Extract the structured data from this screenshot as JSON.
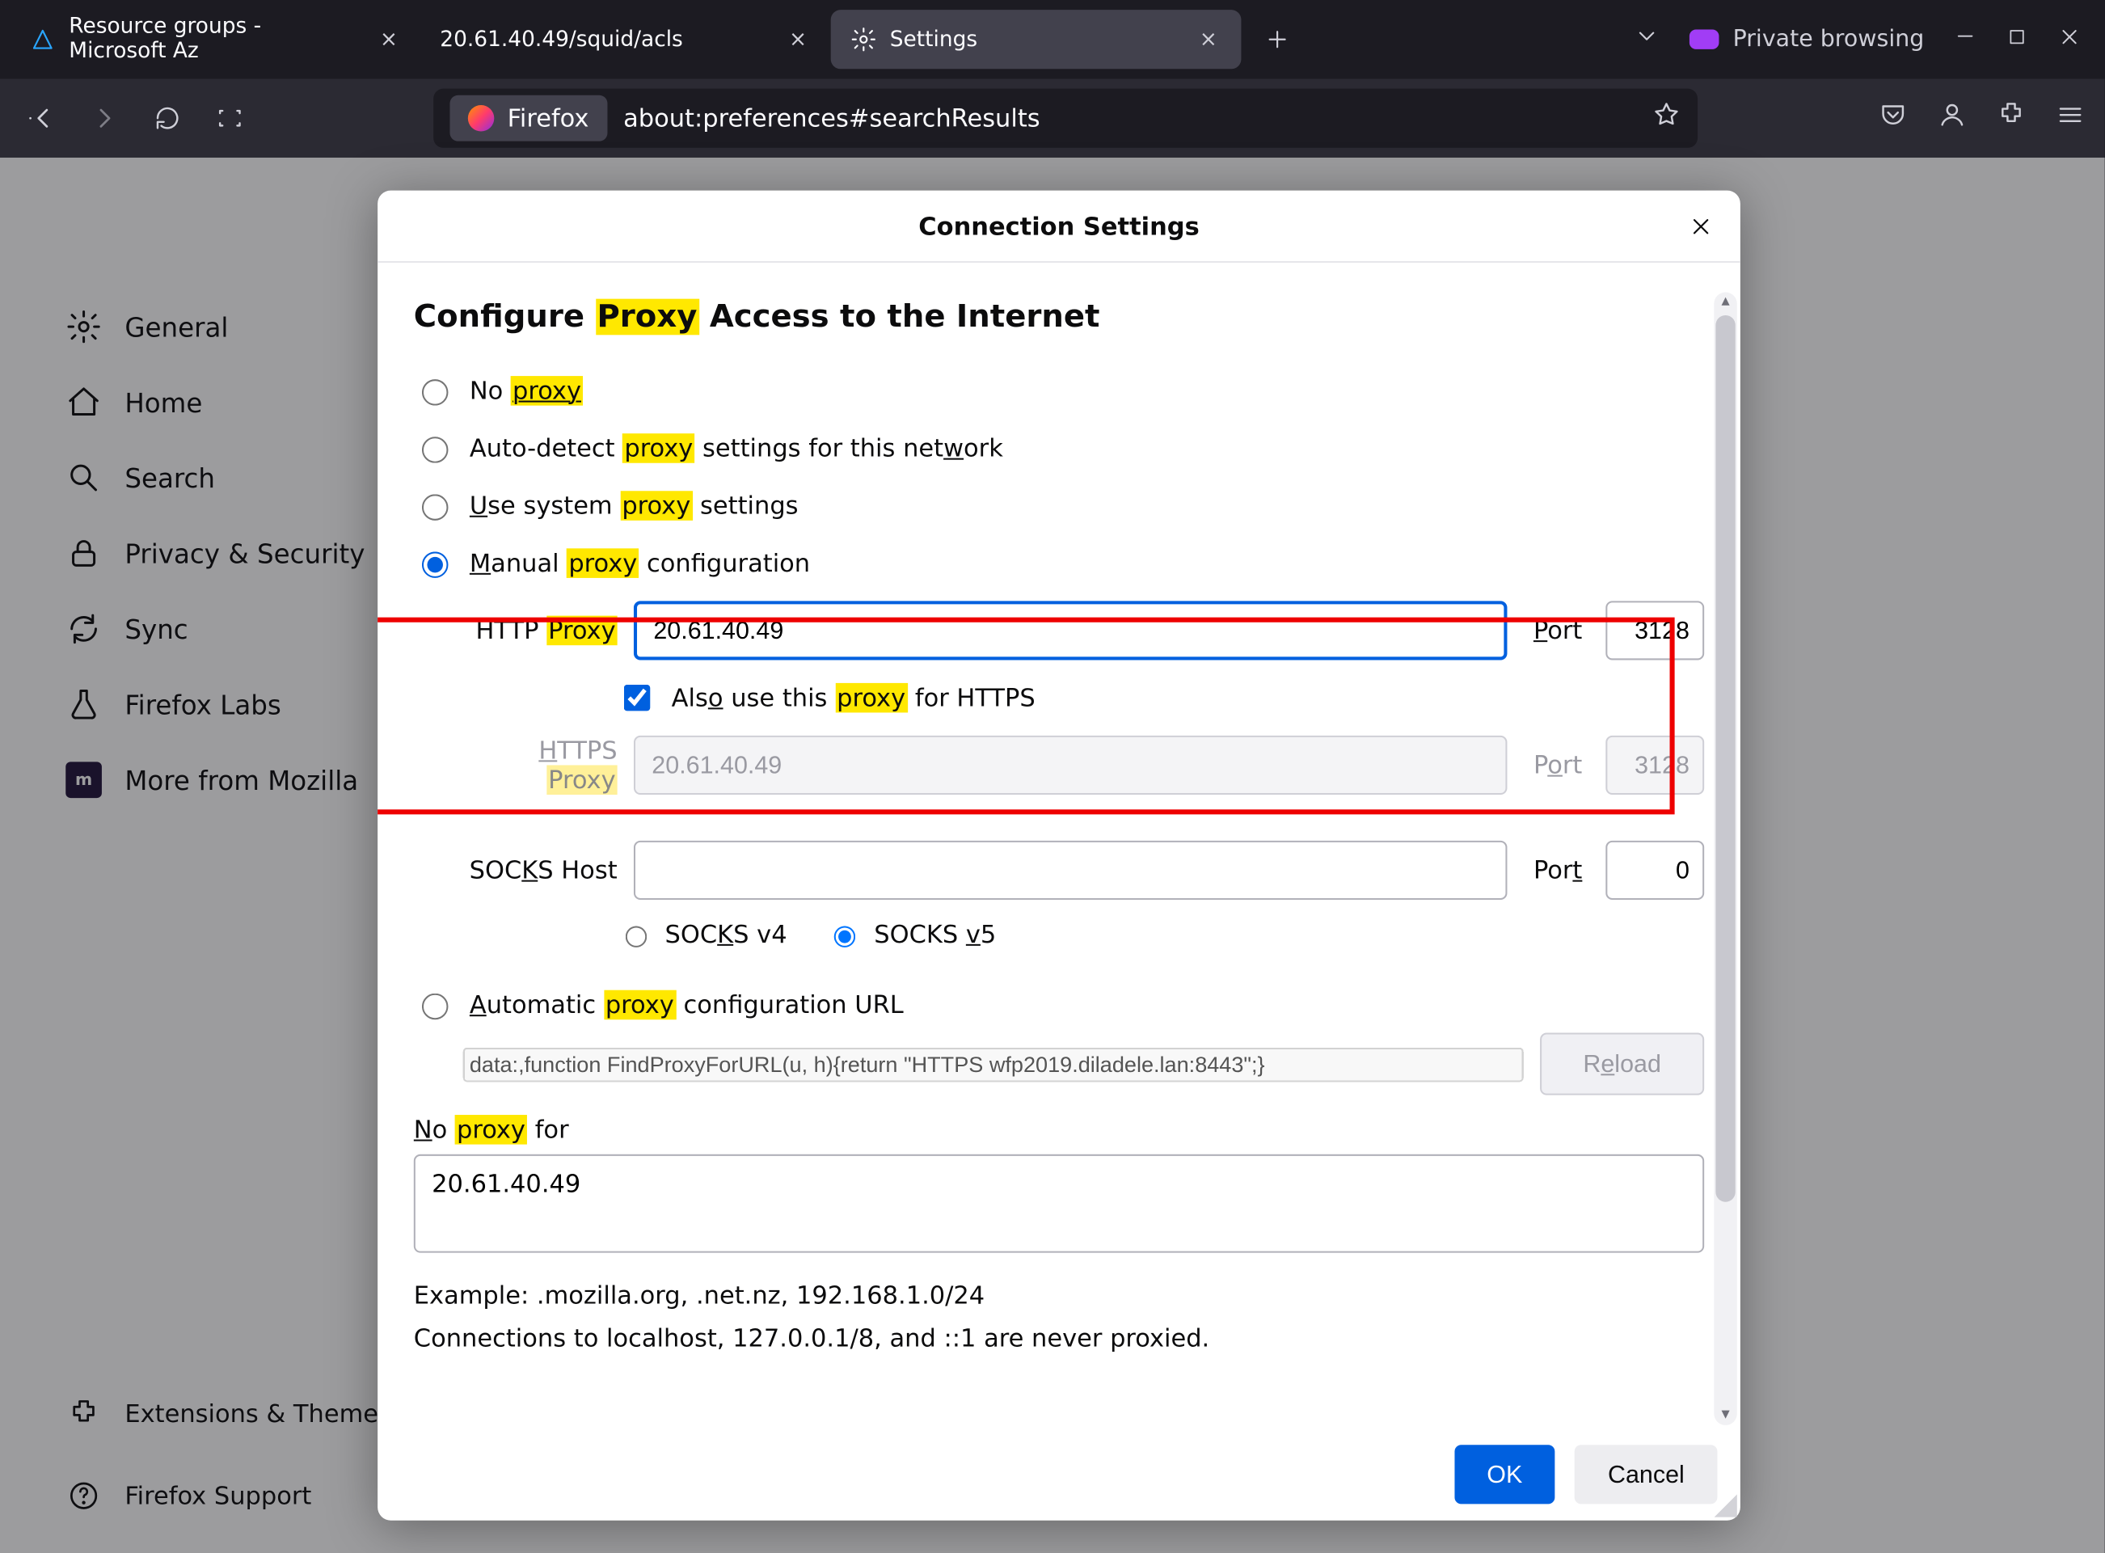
{
  "tabs": [
    {
      "label": "Resource groups - Microsoft Az",
      "close": "×"
    },
    {
      "label": "20.61.40.49/squid/acls",
      "close": "×"
    },
    {
      "label": "Settings",
      "close": "×",
      "active": true
    }
  ],
  "tabstrip": {
    "add_tooltip": "+",
    "private_label": "Private browsing"
  },
  "urlbar": {
    "identity": "Firefox",
    "url": "about:preferences#searchResults"
  },
  "sidebar": {
    "items": [
      {
        "id": "general",
        "label": "General"
      },
      {
        "id": "home",
        "label": "Home"
      },
      {
        "id": "search",
        "label": "Search"
      },
      {
        "id": "privacy",
        "label": "Privacy & Security"
      },
      {
        "id": "sync",
        "label": "Sync"
      },
      {
        "id": "firefox-labs",
        "label": "Firefox Labs"
      },
      {
        "id": "more-mozilla",
        "label": "More from Mozilla"
      }
    ],
    "bottom": [
      {
        "id": "ext-themes",
        "label": "Extensions & Themes"
      },
      {
        "id": "firefox-support",
        "label": "Firefox Support"
      }
    ]
  },
  "dialog": {
    "title": "Connection Settings",
    "heading_pre": "Configure ",
    "heading_hl": "Proxy",
    "heading_post": " Access to the Internet",
    "opt_no_proxy_pre": "No ",
    "opt_no_proxy_hl": "proxy",
    "opt_autodetect_pre": "Auto-detect ",
    "opt_autodetect_hl": "proxy",
    "opt_autodetect_post": " settings for this net",
    "opt_autodetect_u": "w",
    "opt_autodetect_tail": "ork",
    "opt_system_u": "U",
    "opt_system_pre": "se system ",
    "opt_system_hl": "proxy",
    "opt_system_post": " settings",
    "opt_manual_u": "M",
    "opt_manual_pre": "anual ",
    "opt_manual_hl": "proxy",
    "opt_manual_post": " configuration",
    "http_label_pre": "HTTP ",
    "http_label_hl": "Proxy",
    "http_value": "20.61.40.49",
    "port_label_u": "P",
    "port_label_rest": "ort",
    "http_port": "3128",
    "also_https_pre": "Als",
    "also_https_u": "o",
    "also_https_mid": " use this ",
    "also_https_hl": "proxy",
    "also_https_post": " for HTTPS",
    "https_label_u": "H",
    "https_label_pre": "TTPS ",
    "https_label_hl": "Proxy",
    "https_value": "20.61.40.49",
    "https_port_u": "o",
    "https_port_pre": "P",
    "https_port_rest": "rt",
    "https_port": "3128",
    "socks_label_pre": "SOC",
    "socks_label_u": "K",
    "socks_label_post": "S Host",
    "socks_value": "",
    "socks_port_pre": "Por",
    "socks_port_u": "t",
    "socks_port": "0",
    "socks4_pre": "SOC",
    "socks4_u": "K",
    "socks4_post": "S v4",
    "socks5_pre": "SOCKS ",
    "socks5_u": "v",
    "socks5_post": "5",
    "opt_auto_u": "A",
    "opt_auto_pre": "utomatic ",
    "opt_auto_hl": "proxy",
    "opt_auto_post": " configuration URL",
    "pac_value": "data:,function FindProxyForURL(u, h){return \"HTTPS wfp2019.diladele.lan:8443\";}",
    "reload_pre": "R",
    "reload_u": "e",
    "reload_post": "load",
    "noproxy_u": "N",
    "noproxy_pre": "o ",
    "noproxy_hl": "proxy",
    "noproxy_post": " for",
    "noproxy_value": "20.61.40.49",
    "example": "Example: .mozilla.org, .net.nz, 192.168.1.0/24",
    "localhost_note": "Connections to localhost, 127.0.0.1/8, and ::1 are never proxied.",
    "ok": "OK",
    "cancel": "Cancel"
  }
}
